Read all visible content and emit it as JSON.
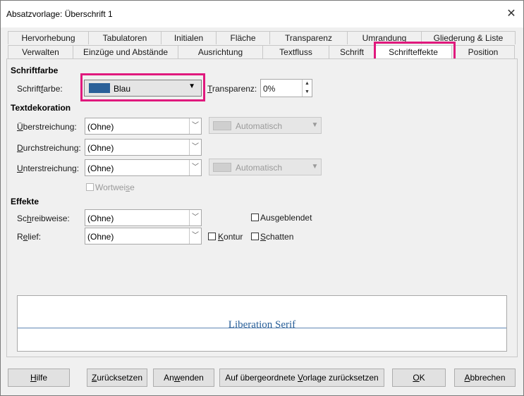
{
  "window": {
    "title": "Absatzvorlage: Überschrift 1",
    "close": "✕"
  },
  "tabs": {
    "row1": [
      {
        "label": "Hervorhebung"
      },
      {
        "label": "Tabulatoren"
      },
      {
        "label": "Initialen"
      },
      {
        "label": "Fläche"
      },
      {
        "label": "Transparenz"
      },
      {
        "label": "Umrandung"
      },
      {
        "label": "Gliederung & Liste"
      }
    ],
    "row2": [
      {
        "label": "Verwalten"
      },
      {
        "label": "Einzüge und Abstände"
      },
      {
        "label": "Ausrichtung"
      },
      {
        "label": "Textfluss"
      },
      {
        "label": "Schrift"
      },
      {
        "label": "Schrifteffekte",
        "active": true
      },
      {
        "label": "Position"
      }
    ]
  },
  "schriftfarbe": {
    "section": "Schriftfarbe",
    "label_pre": "Schrift",
    "label_acc": "f",
    "label_post": "arbe:",
    "color_value": "Blau",
    "color_hex": "#2a6099",
    "transparency_label_acc": "T",
    "transparency_label_post": "ransparenz:",
    "transparency_value": "0%"
  },
  "textdekoration": {
    "section": "Textdekoration",
    "overline_label_acc": "Ü",
    "overline_label_post": "berstreichung:",
    "overline_value": "(Ohne)",
    "overline_color": "Automatisch",
    "strike_label_acc": "D",
    "strike_label_post": "urchstreichung:",
    "strike_value": "(Ohne)",
    "underline_label_acc": "U",
    "underline_label_post": "nterstreichung:",
    "underline_value": "(Ohne)",
    "underline_color": "Automatisch",
    "wordwise_pre": "Wortwei",
    "wordwise_acc": "s",
    "wordwise_post": "e"
  },
  "effekte": {
    "section": "Effekte",
    "case_label_pre": "Sc",
    "case_label_acc": "h",
    "case_label_post": "reibweise:",
    "case_value": "(Ohne)",
    "relief_label_pre": "R",
    "relief_label_acc": "e",
    "relief_label_post": "lief:",
    "relief_value": "(Ohne)",
    "hidden_pre": "Aus",
    "hidden_acc": "g",
    "hidden_post": "eblendet",
    "outline_acc": "K",
    "outline_post": "ontur",
    "shadow_acc": "S",
    "shadow_post": "chatten"
  },
  "preview": {
    "sample_text": "Liberation Serif"
  },
  "buttons": {
    "help_acc": "H",
    "help_post": "ilfe",
    "reset_acc": "Z",
    "reset_post": "urücksetzen",
    "apply_pre": "An",
    "apply_acc": "w",
    "apply_post": "enden",
    "reset_parent_pre": "Auf übergeordnete ",
    "reset_parent_acc": "V",
    "reset_parent_post": "orlage zurücksetzen",
    "ok_acc": "O",
    "ok_post": "K",
    "cancel_acc": "A",
    "cancel_post": "bbrechen"
  }
}
